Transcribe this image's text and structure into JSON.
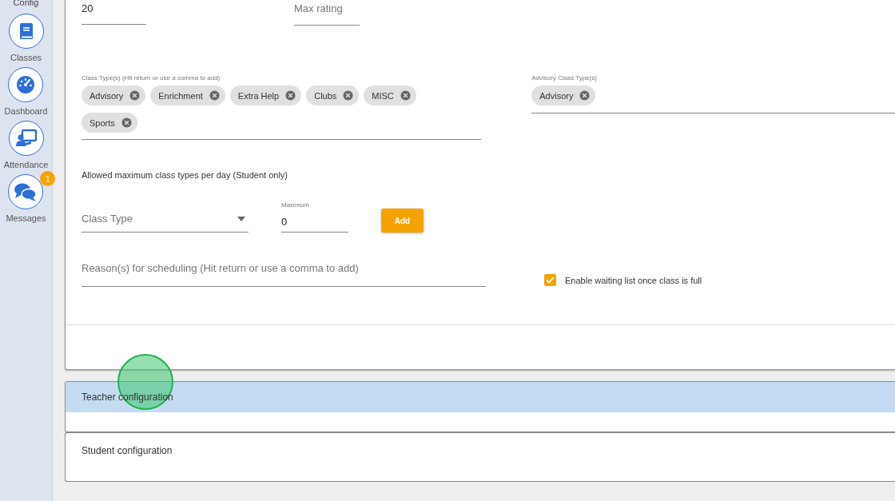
{
  "sidebar": {
    "top_label": "Config",
    "items": [
      {
        "label": "Classes"
      },
      {
        "label": "Dashboard"
      },
      {
        "label": "Attendance"
      },
      {
        "label": "Messages",
        "badge": "1"
      }
    ]
  },
  "form": {
    "size": {
      "value": "20"
    },
    "max_rating": {
      "placeholder": "Max rating"
    },
    "class_types": {
      "label": "Class Type(s) (Hit return or use a comma to add)",
      "chips": [
        "Advisory",
        "Enrichment",
        "Extra Help",
        "Clubs",
        "MISC",
        "Sports"
      ]
    },
    "advisory_class_types": {
      "label": "Advisory Class Type(s)",
      "chips": [
        "Advisory"
      ]
    },
    "max_per_day_heading": "Allowed maximum class types per day (Student only)",
    "class_type_select": {
      "placeholder": "Class Type"
    },
    "maximum": {
      "label": "Maximum",
      "value": "0"
    },
    "add_button": "Add",
    "reasons": {
      "placeholder": "Reason(s) for scheduling (Hit return or use a comma to add)"
    },
    "waiting_list": {
      "label": "Enable waiting list once class is full",
      "checked": true
    }
  },
  "panels": [
    {
      "title": "Teacher configuration",
      "selected": true
    },
    {
      "title": "Student configuration",
      "selected": false
    }
  ]
}
